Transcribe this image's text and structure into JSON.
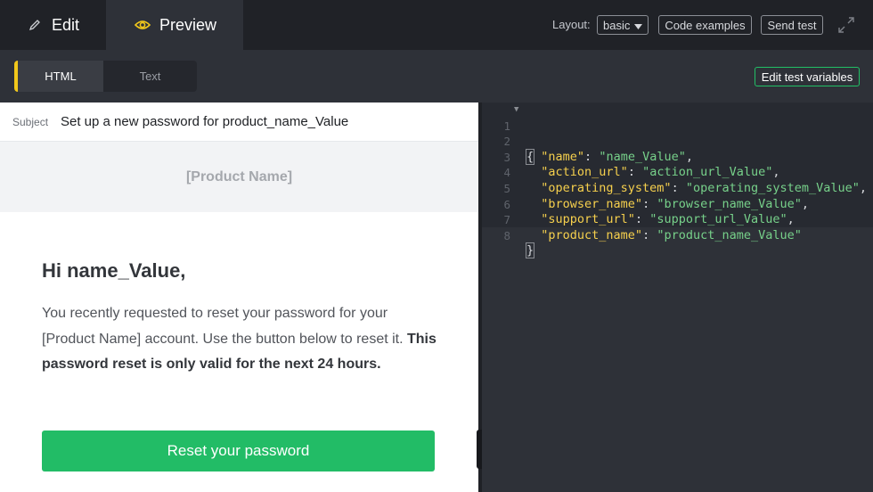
{
  "topbar": {
    "edit_label": "Edit",
    "preview_label": "Preview",
    "layout_label": "Layout:",
    "layout_value": "basic",
    "code_examples_label": "Code examples",
    "send_test_label": "Send test"
  },
  "mode_toggle": {
    "html_label": "HTML",
    "text_label": "Text",
    "edit_vars_label": "Edit test variables"
  },
  "preview": {
    "subject_label": "Subject",
    "subject_value": "Set up a new password for product_name_Value",
    "header_product": "[Product Name]",
    "greeting": "Hi name_Value,",
    "body_plain": "You recently requested to reset your password for your [Product Name] account. Use the button below to reset it. ",
    "body_bold": "This password reset is only valid for the next 24 hours.",
    "button_label": "Reset your password"
  },
  "editor": {
    "line_numbers": [
      "1",
      "2",
      "3",
      "4",
      "5",
      "6",
      "7",
      "8"
    ],
    "open_brace": "{",
    "close_brace": "}",
    "entries": [
      {
        "key": "\"name\"",
        "value": "\"name_Value\"",
        "sep": ","
      },
      {
        "key": "\"action_url\"",
        "value": "\"action_url_Value\"",
        "sep": ","
      },
      {
        "key": "\"operating_system\"",
        "value": "\"operating_system_Value\"",
        "sep": ","
      },
      {
        "key": "\"browser_name\"",
        "value": "\"browser_name_Value\"",
        "sep": ","
      },
      {
        "key": "\"support_url\"",
        "value": "\"support_url_Value\"",
        "sep": ","
      },
      {
        "key": "\"product_name\"",
        "value": "\"product_name_Value\"",
        "sep": ""
      }
    ]
  },
  "colors": {
    "accent_yellow": "#f2c81b",
    "button_green": "#22bc66",
    "json_key": "#f6d04d",
    "json_string": "#77d18a"
  },
  "icons": {
    "edit": "pencil-icon",
    "preview": "eye-icon",
    "dropdown": "caret-down-icon",
    "expand": "expand-icon",
    "fold": "fold-arrow-icon"
  }
}
